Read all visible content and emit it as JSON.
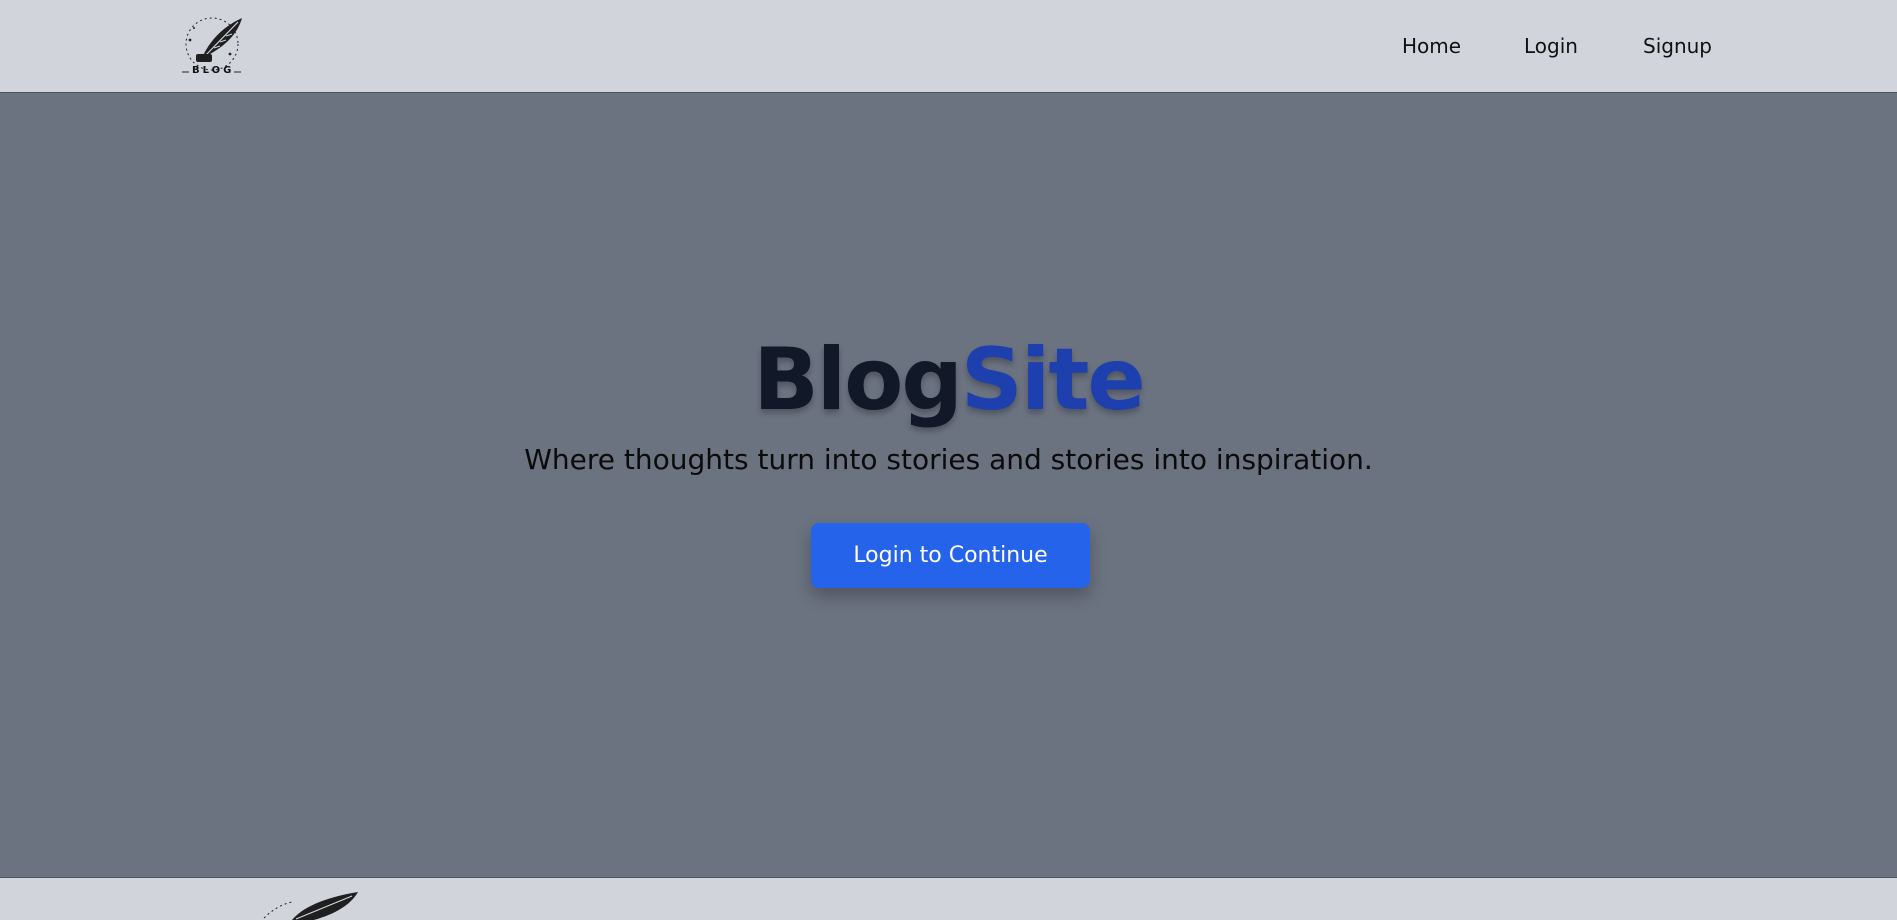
{
  "navbar": {
    "logo_text": "BLOG",
    "links": [
      {
        "label": "Home"
      },
      {
        "label": "Login"
      },
      {
        "label": "Signup"
      }
    ]
  },
  "hero": {
    "title_part1": "Blog",
    "title_part2": "Site",
    "tagline": "Where thoughts turn into stories and stories into inspiration.",
    "cta_label": "Login to Continue"
  },
  "colors": {
    "nav_bg": "#d1d5db",
    "hero_bg": "#6b7280",
    "title_dark": "#111827",
    "title_accent": "#1e40af",
    "button": "#2563eb"
  }
}
